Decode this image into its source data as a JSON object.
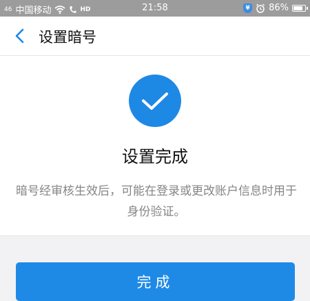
{
  "status_bar": {
    "signal": "46",
    "carrier": "中国移动",
    "hd": "HD",
    "time": "21:58",
    "shield": "¥",
    "battery": "86%",
    "battery_level": 0.86
  },
  "navbar": {
    "title": "设置暗号",
    "back_icon": "chevron-left-icon"
  },
  "result": {
    "icon": "checkmark-icon",
    "title": "设置完成",
    "description": "暗号经审核生效后，可能在登录或更改账户信息时用于身份验证。"
  },
  "actions": {
    "done_label": "完成"
  },
  "colors": {
    "accent": "#1e88e5",
    "status_bar_bg": "#9c9c9c",
    "background": "#f2f2f4",
    "text_secondary": "#858585"
  }
}
